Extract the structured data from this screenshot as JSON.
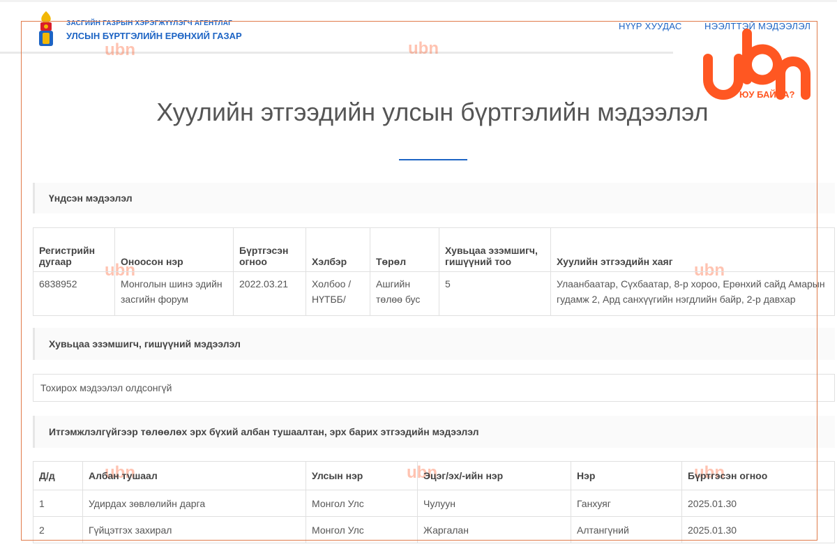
{
  "header": {
    "agency": "ЗАСГИЙН ГАЗРЫН ХЭРЭГЖҮҮЛЭГЧ АГЕНТЛАГ",
    "department": "УЛСЫН БҮРТГЭЛИЙН ЕРӨНХИЙ ГАЗАР",
    "nav": {
      "home": "НҮҮР ХУУДАС",
      "public_info": "НЭЭЛТТЭЙ МЭДЭЭЛЭЛ"
    }
  },
  "watermark": {
    "logo_icon": "ubn-logo-icon",
    "tagline": "ЮУ БАЙНА?"
  },
  "page": {
    "title": "Хуулийн этгээдийн улсын бүртгэлийн мэдээлэл"
  },
  "basic": {
    "heading": "Үндсэн мэдээлэл",
    "columns": [
      "Регистрийн дугаар",
      "Оноосон нэр",
      "Бүртгэсэн огноо",
      "Хэлбэр",
      "Төрөл",
      "Хувьцаа эзэмшигч, гишүүний тоо",
      "Хуулийн этгээдийн хаяг"
    ],
    "row": [
      "6838952",
      "Монголын шинэ эдийн засгийн форум",
      "2022.03.21",
      "Холбоо / НҮТББ/",
      "Ашгийн төлөө бус",
      "5",
      "Улаанбаатар, Сүхбаатар, 8-р хороо, Ерөнхий сайд Амарын гудамж 2, Ард санхүүгийн нэгдлийн байр, 2-р давхар"
    ]
  },
  "shareholders": {
    "heading": "Хувьцаа эзэмшигч, гишүүний мэдээлэл",
    "empty_text": "Тохирох мэдээлэл олдсонгүй"
  },
  "officials": {
    "heading": "Итгэмжлэлгүйгээр төлөөлөх эрх бүхий албан тушаалтан, эрх барих этгээдийн мэдээлэл",
    "columns": [
      "Д/д",
      "Албан тушаал",
      "Улсын нэр",
      "Эцэг/эх/-ийн нэр",
      "Нэр",
      "Бүртгэсэн огноо"
    ],
    "rows": [
      [
        "1",
        "Удирдах зөвлөлийн дарга",
        "Монгол Улс",
        "Чулуун",
        "Ганхуяг",
        "2025.01.30"
      ],
      [
        "2",
        "Гүйцэтгэх захирал",
        "Монгол Улс",
        "Жаргалан",
        "Алтангүний",
        "2025.01.30"
      ]
    ]
  },
  "colors": {
    "brand_blue": "#1d64c4",
    "ubn_orange": "#ff5722"
  }
}
